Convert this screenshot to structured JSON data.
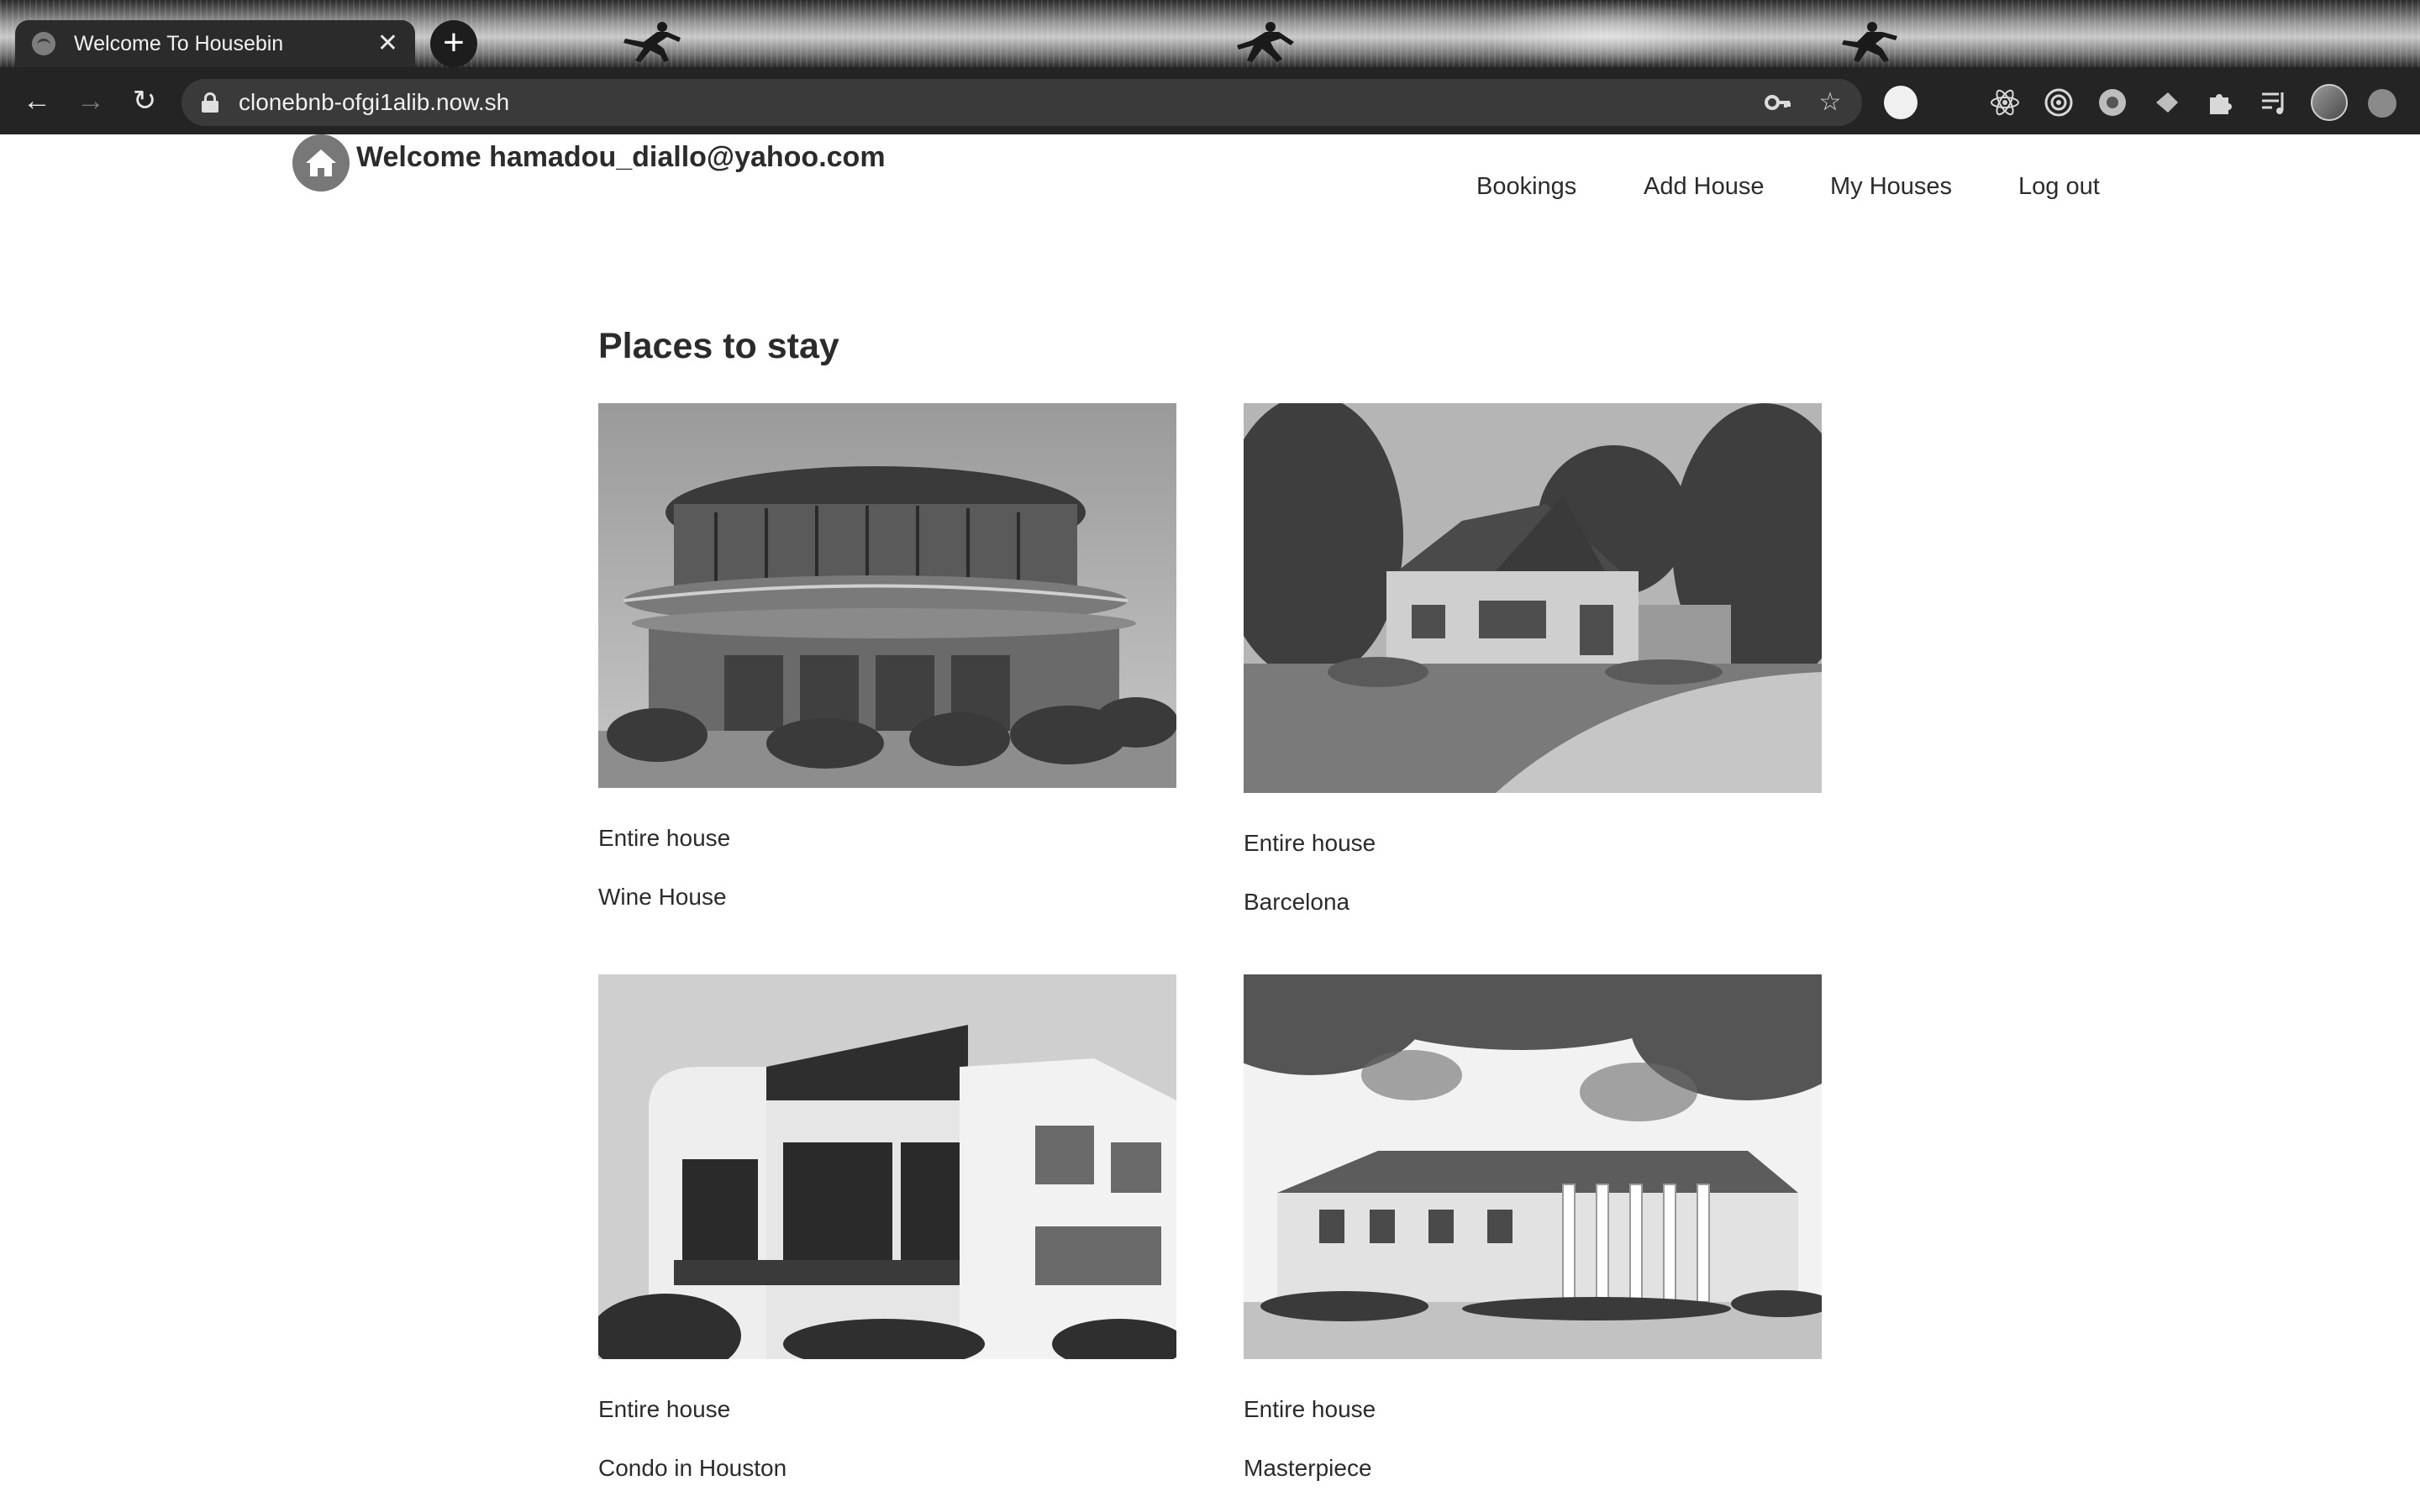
{
  "browser": {
    "tab_title": "Welcome To Housebin",
    "tab_close": "✕",
    "new_tab": "+",
    "url": "clonebnb-ofgi1alib.now.sh",
    "back": "←",
    "forward": "→",
    "reload": "↻",
    "key_icon": "key-icon",
    "star": "☆",
    "extensions": [
      "react-icon",
      "target-icon",
      "chrome-ext-icon",
      "rocket-icon",
      "puzzle-icon",
      "reading-list-icon"
    ]
  },
  "header": {
    "welcome": "Welcome hamadou_diallo@yahoo.com",
    "nav": [
      "Bookings",
      "Add House",
      "My Houses",
      "Log out"
    ]
  },
  "main": {
    "title": "Places to stay",
    "houses": [
      {
        "type": "Entire house",
        "name": "Wine House"
      },
      {
        "type": "Entire house",
        "name": "Barcelona"
      },
      {
        "type": "Entire house",
        "name": "Condo in Houston"
      },
      {
        "type": "Entire house",
        "name": "Masterpiece"
      }
    ]
  },
  "colors": {
    "chrome_bg": "#242424",
    "omnibox": "#3a3a3a",
    "text": "#2b2b2b",
    "logo": "#787878"
  }
}
